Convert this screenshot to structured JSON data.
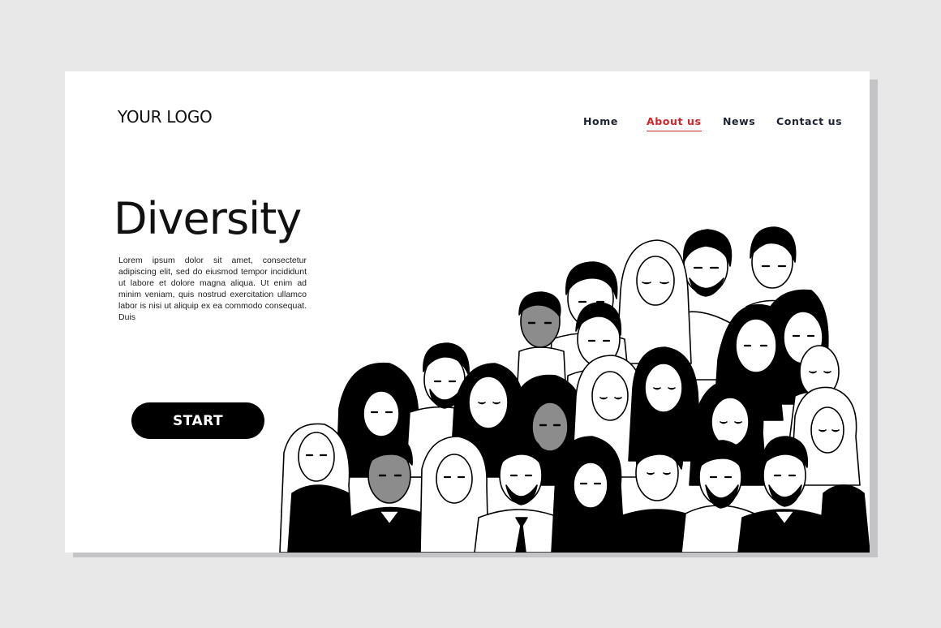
{
  "header": {
    "logo": "YOUR LOGO",
    "nav": [
      {
        "label": "Home",
        "active": false
      },
      {
        "label": "About us",
        "active": true
      },
      {
        "label": "News",
        "active": false
      },
      {
        "label": "Contact us",
        "active": false
      }
    ]
  },
  "hero": {
    "title": "Diversity",
    "body": "Lorem ipsum dolor sit amet, consectetur adipiscing elit, sed do eiusmod tempor incididunt ut labore et dolore magna aliqua. Ut enim ad  minim veniam, quis nostrud exercitation ullamco  labor is nisi ut aliquip ex ea commodo consequat. Duis",
    "cta_label": "START"
  },
  "illustration": {
    "subject": "crowd-of-diverse-people"
  },
  "colors": {
    "background": "#e8e8e9",
    "page": "#ffffff",
    "accent": "#d0242b",
    "nav_text": "#1c2233",
    "button": "#000000"
  }
}
